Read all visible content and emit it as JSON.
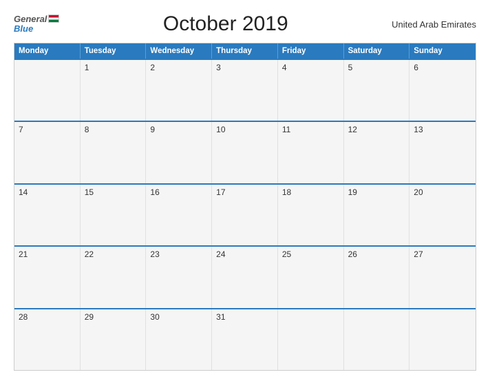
{
  "header": {
    "logo_general": "General",
    "logo_blue": "Blue",
    "title": "October 2019",
    "country": "United Arab Emirates"
  },
  "weekdays": [
    "Monday",
    "Tuesday",
    "Wednesday",
    "Thursday",
    "Friday",
    "Saturday",
    "Sunday"
  ],
  "weeks": [
    [
      "",
      "1",
      "2",
      "3",
      "4",
      "5",
      "6"
    ],
    [
      "7",
      "8",
      "9",
      "10",
      "11",
      "12",
      "13"
    ],
    [
      "14",
      "15",
      "16",
      "17",
      "18",
      "19",
      "20"
    ],
    [
      "21",
      "22",
      "23",
      "24",
      "25",
      "26",
      "27"
    ],
    [
      "28",
      "29",
      "30",
      "31",
      "",
      "",
      ""
    ]
  ]
}
